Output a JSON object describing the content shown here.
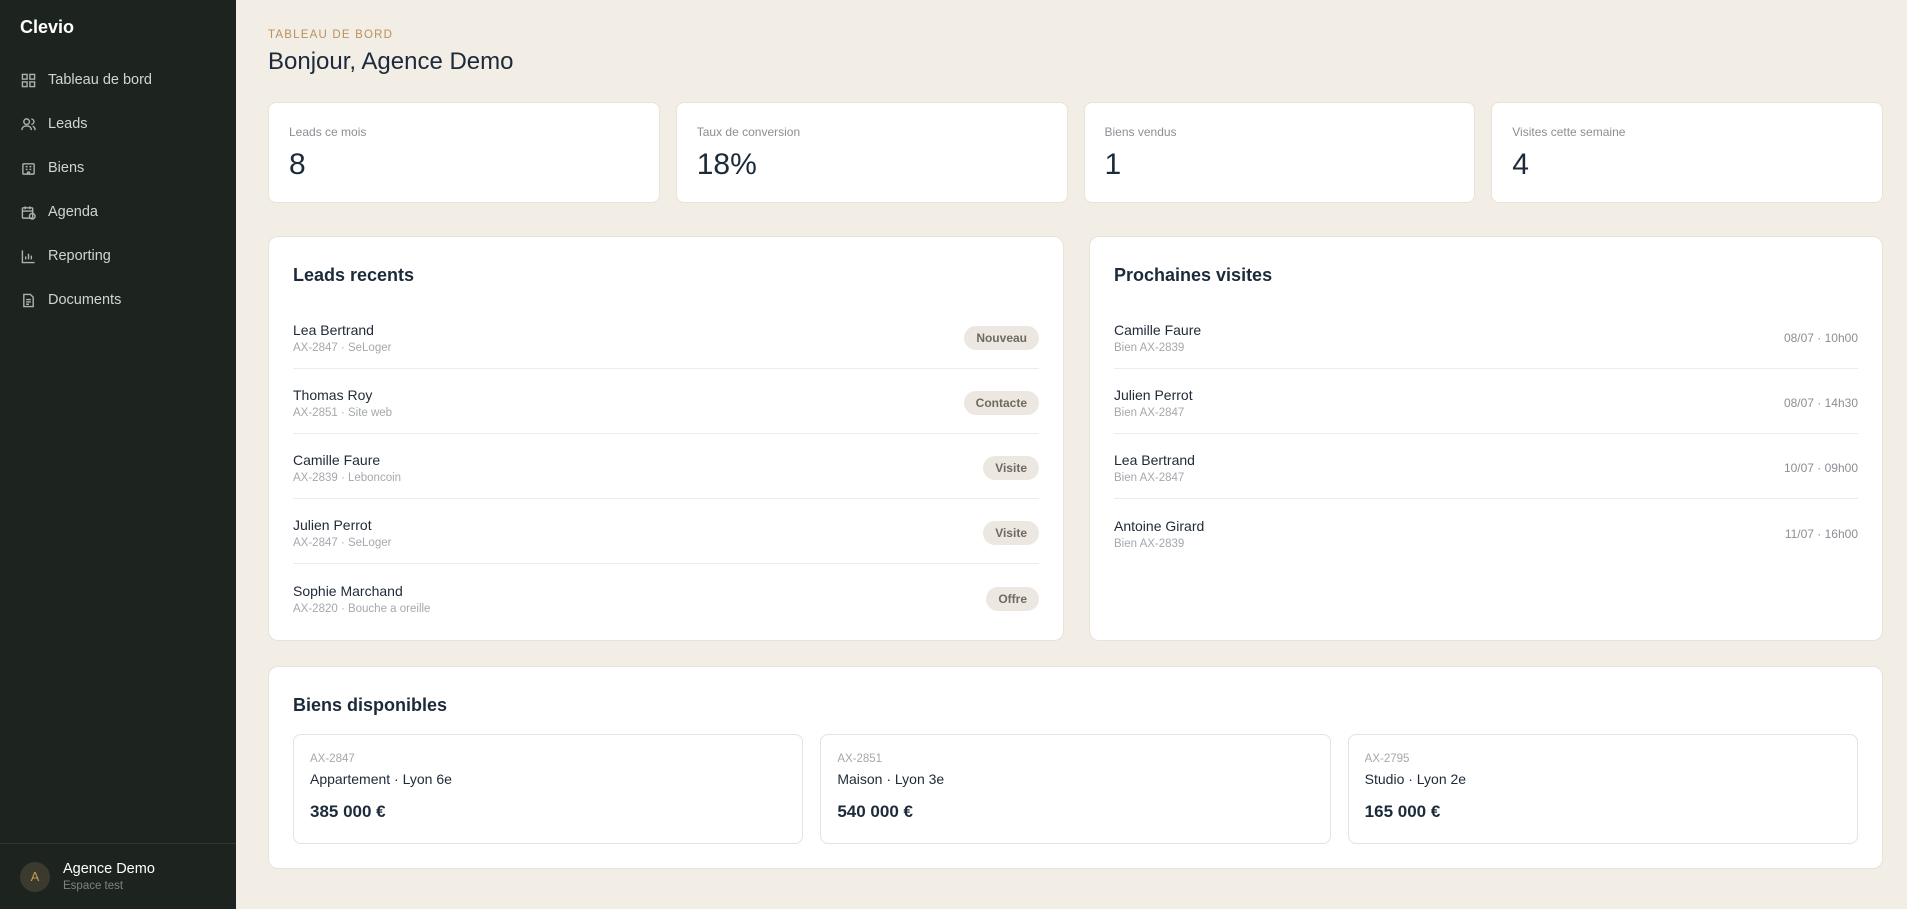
{
  "app": {
    "name": "Clevio"
  },
  "nav": [
    {
      "label": "Tableau de bord",
      "icon": "dashboard-icon"
    },
    {
      "label": "Leads",
      "icon": "users-icon"
    },
    {
      "label": "Biens",
      "icon": "building-icon"
    },
    {
      "label": "Agenda",
      "icon": "calendar-icon"
    },
    {
      "label": "Reporting",
      "icon": "bar-chart-icon"
    },
    {
      "label": "Documents",
      "icon": "document-icon"
    }
  ],
  "user": {
    "initial": "A",
    "name": "Agence Demo",
    "sub": "Espace test"
  },
  "header": {
    "eyebrow": "TABLEAU DE BORD",
    "title": "Bonjour, Agence Demo"
  },
  "stats": [
    {
      "label": "Leads ce mois",
      "value": "8"
    },
    {
      "label": "Taux de conversion",
      "value": "18%"
    },
    {
      "label": "Biens vendus",
      "value": "1"
    },
    {
      "label": "Visites cette semaine",
      "value": "4"
    }
  ],
  "leads": {
    "title": "Leads recents",
    "items": [
      {
        "name": "Lea Bertrand",
        "sub": "AX-2847 · SeLoger",
        "status": "Nouveau"
      },
      {
        "name": "Thomas Roy",
        "sub": "AX-2851 · Site web",
        "status": "Contacte"
      },
      {
        "name": "Camille Faure",
        "sub": "AX-2839 · Leboncoin",
        "status": "Visite"
      },
      {
        "name": "Julien Perrot",
        "sub": "AX-2847 · SeLoger",
        "status": "Visite"
      },
      {
        "name": "Sophie Marchand",
        "sub": "AX-2820 · Bouche a oreille",
        "status": "Offre"
      }
    ]
  },
  "visits": {
    "title": "Prochaines visites",
    "items": [
      {
        "name": "Camille Faure",
        "sub": "Bien AX-2839",
        "when": "08/07 · 10h00"
      },
      {
        "name": "Julien Perrot",
        "sub": "Bien AX-2847",
        "when": "08/07 · 14h30"
      },
      {
        "name": "Lea Bertrand",
        "sub": "Bien AX-2847",
        "when": "10/07 · 09h00"
      },
      {
        "name": "Antoine Girard",
        "sub": "Bien AX-2839",
        "when": "11/07 · 16h00"
      }
    ]
  },
  "biens": {
    "title": "Biens disponibles",
    "items": [
      {
        "ref": "AX-2847",
        "type": "Appartement · Lyon 6e",
        "price": "385 000 €"
      },
      {
        "ref": "AX-2851",
        "type": "Maison · Lyon 3e",
        "price": "540 000 €"
      },
      {
        "ref": "AX-2795",
        "type": "Studio · Lyon 2e",
        "price": "165 000 €"
      }
    ]
  }
}
